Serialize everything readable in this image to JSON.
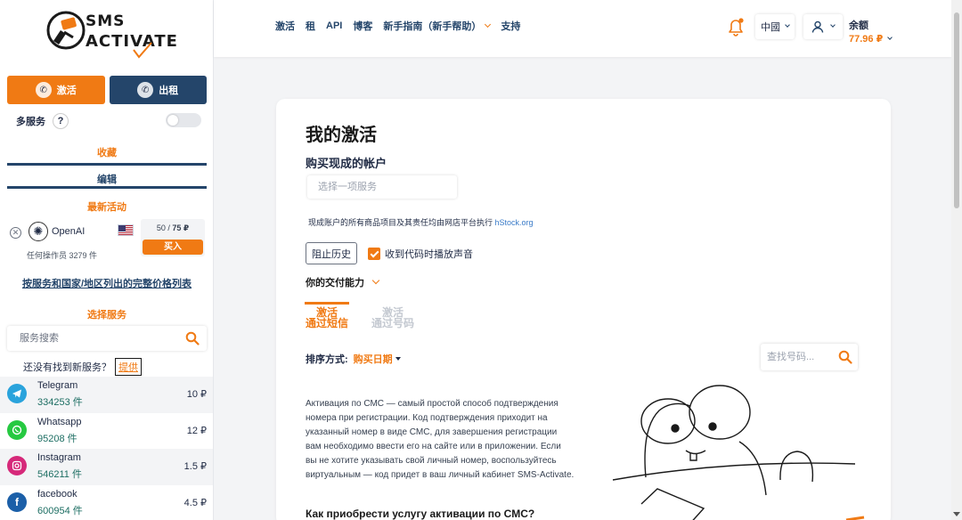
{
  "logo": {
    "line1": "SMS",
    "line2": "ACTIVATE"
  },
  "sidebar": {
    "mode_buttons": [
      {
        "label": "激活"
      },
      {
        "label": "出租"
      }
    ],
    "multi_service": {
      "label": "多服务",
      "help": "?",
      "enabled": false
    },
    "tabs": {
      "favorites": "收藏",
      "edit": "编辑",
      "latest": "最新活动"
    },
    "latest_offer": {
      "service": "OpenAI",
      "operators": "任何操作员 ",
      "count": "3279 件",
      "price_available": "50",
      "price_separator": " / ",
      "price_total": "75 ₽",
      "buy_label": "买入"
    },
    "full_price_list": "按服务和国家/地区列出的完整价格列表",
    "choose_service": "选择服务",
    "search_placeholder": "服务搜索",
    "not_found_text": "还没有找到新服务？",
    "provide_label": "提供",
    "services": [
      {
        "name": "Telegram",
        "count": "334253 件",
        "price": "10 ₽",
        "icon": "telegram-icon",
        "color": "#2aa3dc"
      },
      {
        "name": "Whatsapp",
        "count": "95208 件",
        "price": "12 ₽",
        "icon": "whatsapp-icon",
        "color": "#26c941"
      },
      {
        "name": "Instagram",
        "count": "546211 件",
        "price": "1.5 ₽",
        "icon": "instagram-icon",
        "color": "#d6297a"
      },
      {
        "name": "facebook",
        "count": "600954 件",
        "price": "4.5 ₽",
        "icon": "facebook-icon",
        "color": "#1b5fa8"
      }
    ]
  },
  "header": {
    "nav": [
      "激活",
      "租",
      "API",
      "博客",
      "新手指南（新手帮助）",
      "支持"
    ],
    "language": "中國",
    "balance_label": "余额",
    "balance_value": "77.96 ₽"
  },
  "main": {
    "title": "我的激活",
    "subtitle": "购买现成的帐户",
    "service_select_placeholder": "选择一项服务",
    "disclaimer": "现成账户的所有商品项目及其责任均由网店平台执行 ",
    "disclaimer_link": "hStock.org",
    "history_button": "阻止历史",
    "sound_checkbox": "收到代码时播放声音",
    "delivery_capacity": "你的交付能力",
    "tabs": [
      {
        "line1": "激活",
        "line2": "通过短信"
      },
      {
        "line1": "激活",
        "line2": "通过号码"
      }
    ],
    "sort_label": "排序方式:",
    "sort_value": "购买日期",
    "number_search_placeholder": "查找号码...",
    "description": "Активация по СМС — самый простой способ подтверждения номера при регистрации. Код подтверждения приходит на указанный номер в виде СМС, для завершения регистрации вам необходимо ввести его на сайте или в приложении. Если вы не хотите указывать свой личный номер, воспользуйтесь виртуальным — код придет в ваш личный кабинет SMS-Activate.",
    "how_title": "Как приобрести услугу активации по СМС?"
  },
  "colors": {
    "accent": "#f07a14",
    "navy": "#24456a",
    "count": "#1d6e63"
  }
}
